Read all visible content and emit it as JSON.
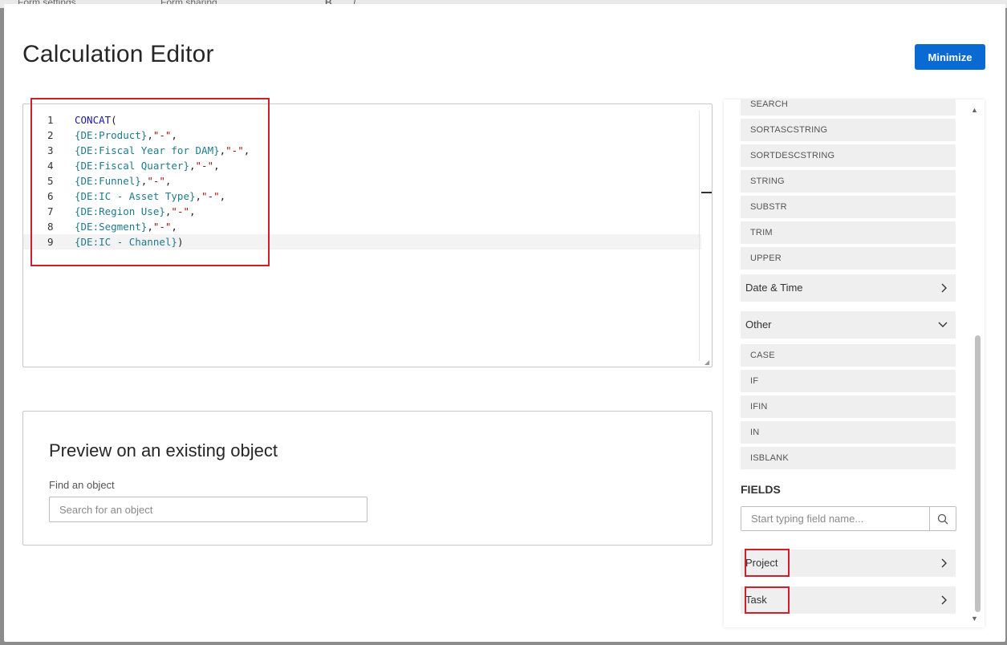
{
  "background": {
    "tabs": [
      "Form settings",
      "Form sharing"
    ],
    "toolbar": [
      "B",
      "I"
    ]
  },
  "modal": {
    "title": "Calculation Editor",
    "minimize_label": "Minimize"
  },
  "editor": {
    "lines": [
      {
        "num": "1",
        "segments": [
          {
            "t": "CONCAT",
            "c": "fn"
          },
          {
            "t": "(",
            "c": "pn"
          }
        ]
      },
      {
        "num": "2",
        "segments": [
          {
            "t": "{DE:Product}",
            "c": "fld"
          },
          {
            "t": ",",
            "c": "pn"
          },
          {
            "t": "\"-\"",
            "c": "str"
          },
          {
            "t": ",",
            "c": "pn"
          }
        ]
      },
      {
        "num": "3",
        "segments": [
          {
            "t": "{DE:Fiscal Year for DAM}",
            "c": "fld"
          },
          {
            "t": ",",
            "c": "pn"
          },
          {
            "t": "\"-\"",
            "c": "str"
          },
          {
            "t": ",",
            "c": "pn"
          }
        ]
      },
      {
        "num": "4",
        "segments": [
          {
            "t": "{DE:Fiscal Quarter}",
            "c": "fld"
          },
          {
            "t": ",",
            "c": "pn"
          },
          {
            "t": "\"-\"",
            "c": "str"
          },
          {
            "t": ",",
            "c": "pn"
          }
        ]
      },
      {
        "num": "5",
        "segments": [
          {
            "t": "{DE:Funnel}",
            "c": "fld"
          },
          {
            "t": ",",
            "c": "pn"
          },
          {
            "t": "\"-\"",
            "c": "str"
          },
          {
            "t": ",",
            "c": "pn"
          }
        ]
      },
      {
        "num": "6",
        "segments": [
          {
            "t": "{DE:IC - Asset Type}",
            "c": "fld"
          },
          {
            "t": ",",
            "c": "pn"
          },
          {
            "t": "\"-\"",
            "c": "str"
          },
          {
            "t": ",",
            "c": "pn"
          }
        ]
      },
      {
        "num": "7",
        "segments": [
          {
            "t": "{DE:Region Use}",
            "c": "fld"
          },
          {
            "t": ",",
            "c": "pn"
          },
          {
            "t": "\"-\"",
            "c": "str"
          },
          {
            "t": ",",
            "c": "pn"
          }
        ]
      },
      {
        "num": "8",
        "segments": [
          {
            "t": "{DE:Segment}",
            "c": "fld"
          },
          {
            "t": ",",
            "c": "pn"
          },
          {
            "t": "\"-\"",
            "c": "str"
          },
          {
            "t": ",",
            "c": "pn"
          }
        ]
      },
      {
        "num": "9",
        "segments": [
          {
            "t": "{DE:IC - Channel}",
            "c": "fld"
          },
          {
            "t": ")",
            "c": "pn"
          }
        ]
      }
    ],
    "active_line": 9
  },
  "preview": {
    "title": "Preview on an existing object",
    "find_label": "Find an object",
    "search_placeholder": "Search for an object"
  },
  "functions_panel": {
    "text_functions": [
      "SEARCH",
      "SORTASCSTRING",
      "SORTDESCSTRING",
      "STRING",
      "SUBSTR",
      "TRIM",
      "UPPER"
    ],
    "date_time_group": {
      "label": "Date & Time",
      "expanded": false
    },
    "other_group": {
      "label": "Other",
      "expanded": true
    },
    "other_functions": [
      "CASE",
      "IF",
      "IFIN",
      "IN",
      "ISBLANK"
    ]
  },
  "fields_panel": {
    "heading": "FIELDS",
    "search_placeholder": "Start typing field name...",
    "objects": [
      "Project",
      "Task"
    ]
  },
  "colors": {
    "primary": "#0a6ad3",
    "highlight": "#d01f2b"
  }
}
